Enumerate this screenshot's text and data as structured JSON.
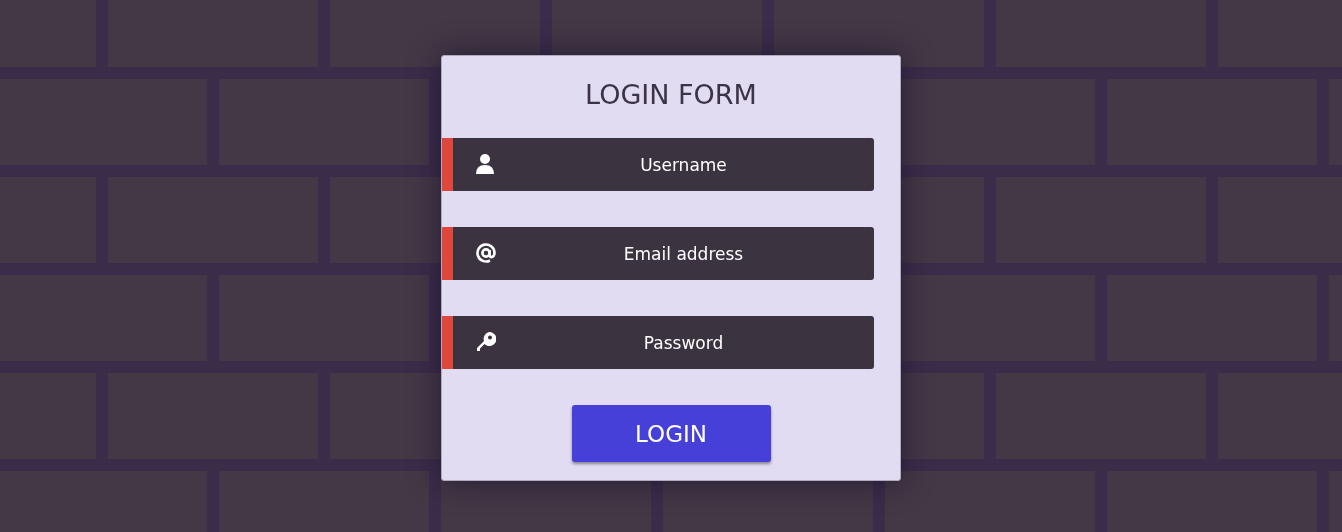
{
  "title": "LOGIN FORM",
  "fields": [
    {
      "kind": "user",
      "placeholder": "Username"
    },
    {
      "kind": "email",
      "placeholder": "Email address"
    },
    {
      "kind": "password",
      "placeholder": "Password"
    }
  ],
  "button": "LOGIN"
}
